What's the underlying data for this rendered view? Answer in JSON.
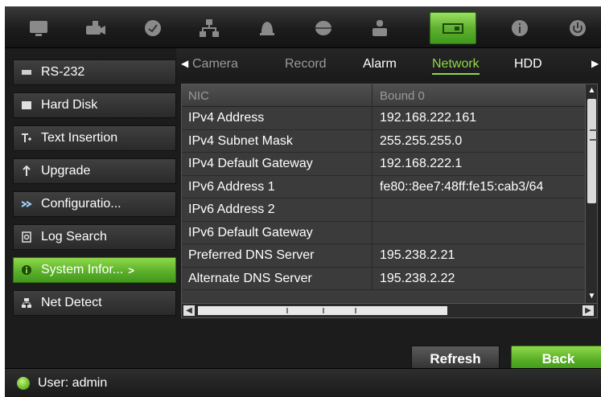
{
  "toolbar": {
    "buttons": [
      {
        "name": "display-icon",
        "active": false
      },
      {
        "name": "camera-icon",
        "active": false
      },
      {
        "name": "record-icon",
        "active": false
      },
      {
        "name": "network-icon",
        "active": false
      },
      {
        "name": "alarm-bell-icon",
        "active": false
      },
      {
        "name": "device-icon",
        "active": false
      },
      {
        "name": "user-icon",
        "active": false
      },
      {
        "name": "system-info-icon",
        "active": true
      },
      {
        "name": "info-icon",
        "active": false
      },
      {
        "name": "power-icon",
        "active": false
      }
    ],
    "accent_color": "#5cb12b"
  },
  "sidebar": {
    "items": [
      {
        "label": "RS-232",
        "icon": "serial-port-icon"
      },
      {
        "label": "Hard Disk",
        "icon": "hard-disk-icon"
      },
      {
        "label": "Text Insertion",
        "icon": "text-insert-icon"
      },
      {
        "label": "Upgrade",
        "icon": "upgrade-icon"
      },
      {
        "label": "Configuratio...",
        "icon": "configuration-icon"
      },
      {
        "label": "Log Search",
        "icon": "log-search-icon"
      },
      {
        "label": "System Infor...",
        "icon": "system-info-icon",
        "active": true,
        "arrow": ">"
      },
      {
        "label": "Net Detect",
        "icon": "net-detect-icon"
      }
    ]
  },
  "tabs": {
    "left_arrow": "◀",
    "right_arrow": "▶",
    "items": [
      {
        "label": "Camera",
        "style": "dim"
      },
      {
        "label": "Record",
        "style": "dim"
      },
      {
        "label": "Alarm",
        "style": "bright"
      },
      {
        "label": "Network",
        "style": "active"
      },
      {
        "label": "HDD",
        "style": "bright"
      }
    ]
  },
  "table": {
    "header": {
      "key": "NIC",
      "value": "Bound 0"
    },
    "rows": [
      {
        "key": "IPv4 Address",
        "value": "192.168.222.161"
      },
      {
        "key": "IPv4 Subnet Mask",
        "value": "255.255.255.0"
      },
      {
        "key": "IPv4 Default Gateway",
        "value": "192.168.222.1"
      },
      {
        "key": "IPv6 Address 1",
        "value": "fe80::8ee7:48ff:fe15:cab3/64"
      },
      {
        "key": "IPv6 Address 2",
        "value": ""
      },
      {
        "key": "IPv6 Default Gateway",
        "value": ""
      },
      {
        "key": "Preferred DNS Server",
        "value": "195.238.2.21"
      },
      {
        "key": "Alternate DNS Server",
        "value": "195.238.2.22"
      }
    ]
  },
  "buttons": {
    "refresh": "Refresh",
    "back": "Back"
  },
  "status": {
    "user_label": "User: admin"
  }
}
